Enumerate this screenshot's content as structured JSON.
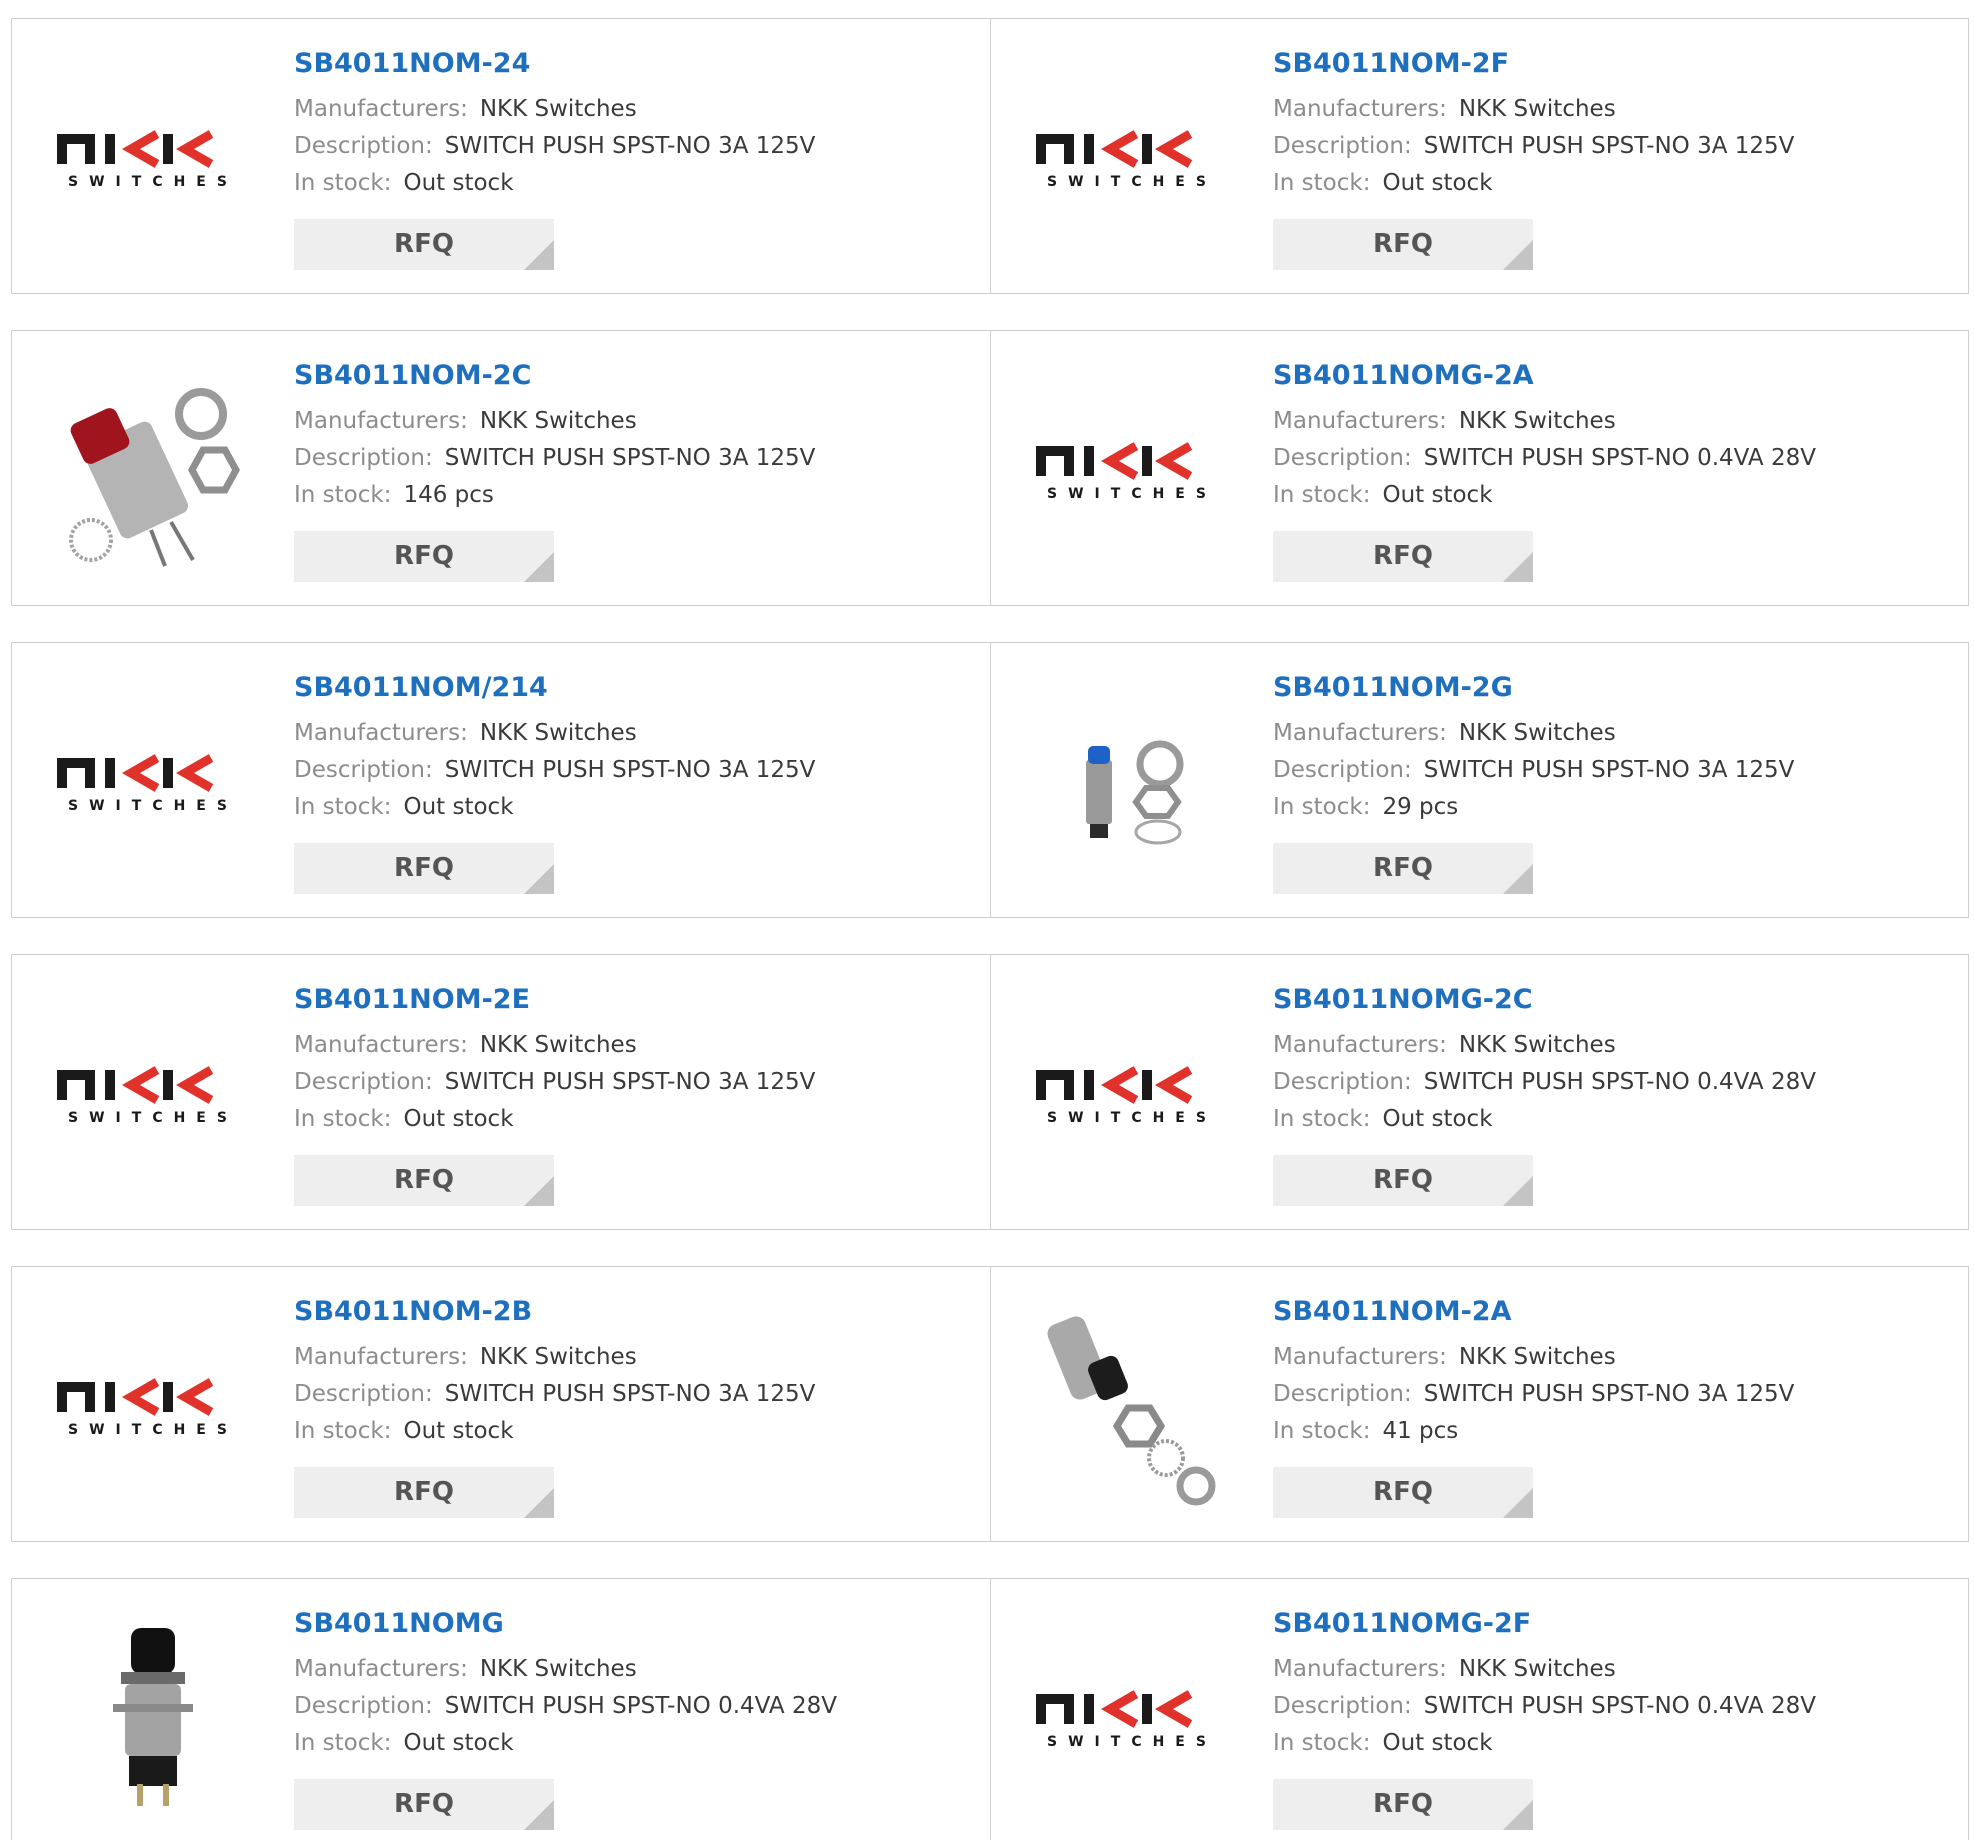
{
  "labels": {
    "manufacturers": "Manufacturers:",
    "description": "Description:",
    "stock": "In stock:",
    "rfq": "RFQ"
  },
  "logo_text": "SWITCHES",
  "colors": {
    "link": "#1f6fbf",
    "logo_red": "#e0312b",
    "border": "#cfcfcf",
    "button_bg": "#eeeeee"
  },
  "products": [
    {
      "part": "SB4011NOM-24",
      "manufacturer": "NKK Switches",
      "description": "SWITCH PUSH SPST-NO 3A 125V",
      "stock": "Out stock",
      "image": "nkk-logo"
    },
    {
      "part": "SB4011NOM-2F",
      "manufacturer": "NKK Switches",
      "description": "SWITCH PUSH SPST-NO 3A 125V",
      "stock": "Out stock",
      "image": "nkk-logo"
    },
    {
      "part": "SB4011NOM-2C",
      "manufacturer": "NKK Switches",
      "description": "SWITCH PUSH SPST-NO 3A 125V",
      "stock": "146 pcs",
      "image": "red-pushbutton-kit"
    },
    {
      "part": "SB4011NOMG-2A",
      "manufacturer": "NKK Switches",
      "description": "SWITCH PUSH SPST-NO 0.4VA 28V",
      "stock": "Out stock",
      "image": "nkk-logo"
    },
    {
      "part": "SB4011NOM/214",
      "manufacturer": "NKK Switches",
      "description": "SWITCH PUSH SPST-NO 3A 125V",
      "stock": "Out stock",
      "image": "nkk-logo"
    },
    {
      "part": "SB4011NOM-2G",
      "manufacturer": "NKK Switches",
      "description": "SWITCH PUSH SPST-NO 3A 125V",
      "stock": "29 pcs",
      "image": "blue-pushbutton-kit"
    },
    {
      "part": "SB4011NOM-2E",
      "manufacturer": "NKK Switches",
      "description": "SWITCH PUSH SPST-NO 3A 125V",
      "stock": "Out stock",
      "image": "nkk-logo"
    },
    {
      "part": "SB4011NOMG-2C",
      "manufacturer": "NKK Switches",
      "description": "SWITCH PUSH SPST-NO 0.4VA 28V",
      "stock": "Out stock",
      "image": "nkk-logo"
    },
    {
      "part": "SB4011NOM-2B",
      "manufacturer": "NKK Switches",
      "description": "SWITCH PUSH SPST-NO 3A 125V",
      "stock": "Out stock",
      "image": "nkk-logo"
    },
    {
      "part": "SB4011NOM-2A",
      "manufacturer": "NKK Switches",
      "description": "SWITCH PUSH SPST-NO 3A 125V",
      "stock": "41 pcs",
      "image": "black-pushbutton-kit"
    },
    {
      "part": "SB4011NOMG",
      "manufacturer": "NKK Switches",
      "description": "SWITCH PUSH SPST-NO 0.4VA 28V",
      "stock": "Out stock",
      "image": "black-pushbutton"
    },
    {
      "part": "SB4011NOMG-2F",
      "manufacturer": "NKK Switches",
      "description": "SWITCH PUSH SPST-NO 0.4VA 28V",
      "stock": "Out stock",
      "image": "nkk-logo"
    }
  ]
}
